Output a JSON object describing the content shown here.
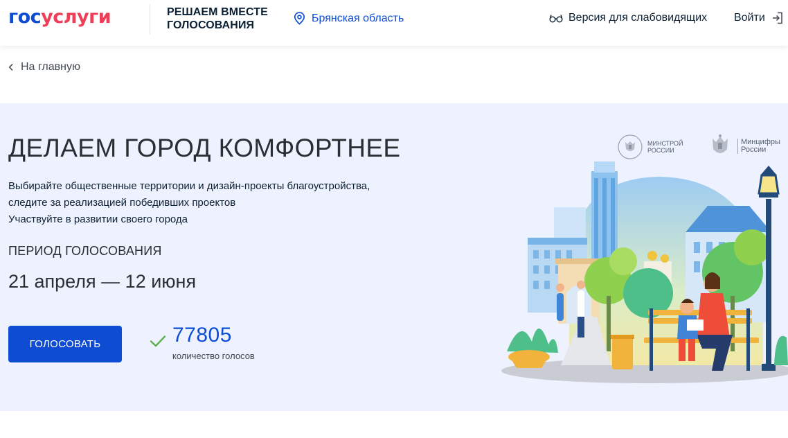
{
  "header": {
    "logo_part1": "гос",
    "logo_part2": "услуги",
    "tagline": "РЕШАЕМ ВМЕСТЕ ГОЛОСОВАНИЯ",
    "region": "Брянская область",
    "low_vision": "Версия для слабовидящих",
    "login": "Войти"
  },
  "breadcrumb": {
    "back": "На главную"
  },
  "hero": {
    "title": "ДЕЛАЕМ ГОРОД КОМФОРТНЕЕ",
    "desc_line1": "Выбирайте общественные территории и дизайн-проекты благоустройства,",
    "desc_line2": "следите за реализацией победивших проектов",
    "desc_line3": "Участвуйте в развитии своего города",
    "period_label": "ПЕРИОД ГОЛОСОВАНИЯ",
    "period_dates": "21 апреля — 12 июня",
    "vote_button": "ГОЛОСОВАТЬ",
    "vote_count": "77805",
    "vote_count_label": "количество голосов"
  },
  "ministries": [
    {
      "line1": "МИНСТРОЙ",
      "line2": "РОССИИ"
    },
    {
      "line1": "Минцифры",
      "line2": "России"
    }
  ],
  "colors": {
    "brand_blue": "#0d4cd3",
    "brand_red": "#ee3f58",
    "hero_bg": "#edf2fe",
    "check_green": "#5bb04c"
  },
  "icons": [
    "location-pin-icon",
    "glasses-icon",
    "login-arrow-icon",
    "chevron-left-icon",
    "checkmark-icon",
    "emblem-icon"
  ]
}
